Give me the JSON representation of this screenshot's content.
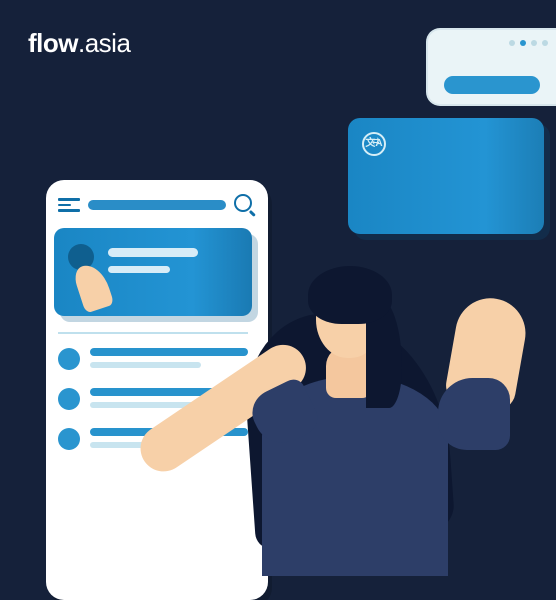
{
  "brand": {
    "bold": "flow",
    "light": ".asia"
  },
  "icons": {
    "menu": "menu-icon",
    "search": "search-icon",
    "translate": "translate-icon"
  }
}
